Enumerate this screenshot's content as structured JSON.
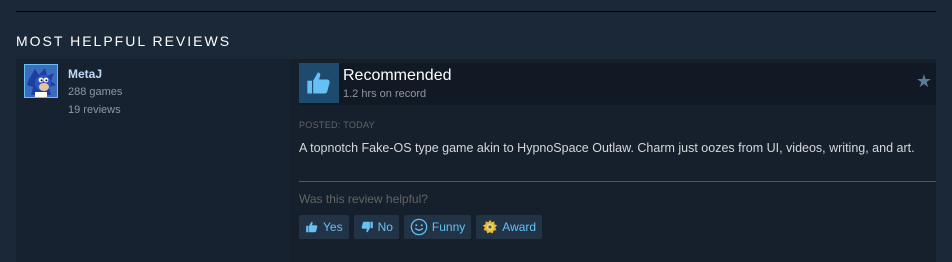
{
  "section": {
    "title": "MOST HELPFUL REVIEWS"
  },
  "review": {
    "author": {
      "name": "MetaJ",
      "games": "288 games",
      "reviews": "19 reviews"
    },
    "vote": {
      "title": "Recommended",
      "hours": "1.2 hrs on record",
      "icon": "thumbs-up-icon"
    },
    "posted": "POSTED: TODAY",
    "text": "A topnotch Fake-OS type game akin to HypnoSpace Outlaw. Charm just oozes from UI, videos, writing, and art.",
    "helpful_question": "Was this review helpful?",
    "buttons": {
      "yes": "Yes",
      "no": "No",
      "funny": "Funny",
      "award": "Award"
    }
  },
  "colors": {
    "background": "#1b2838",
    "accent": "#66c0f4",
    "thumb_bg": "#1e4a6e"
  }
}
